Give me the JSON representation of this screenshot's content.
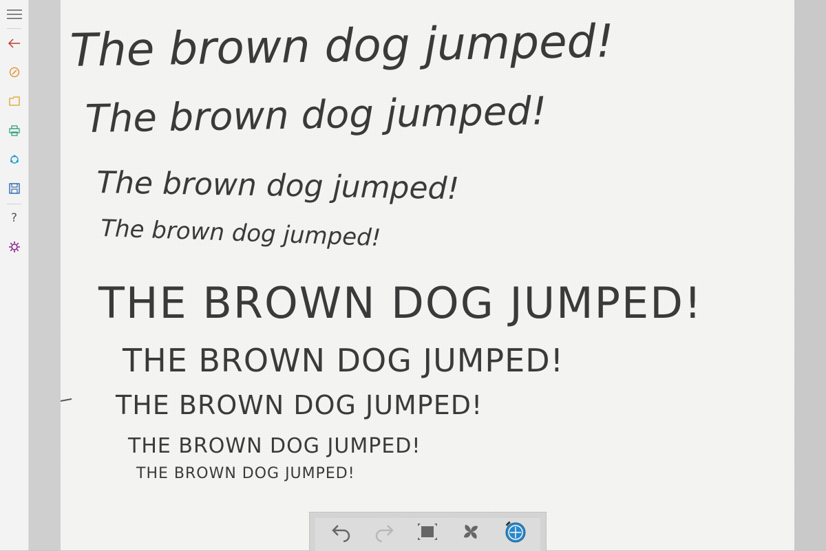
{
  "sidebar": {
    "icons": [
      "menu-icon",
      "back-arrow-icon",
      "pen-color-icon",
      "folder-icon",
      "print-icon",
      "share-icon",
      "save-icon",
      "help-icon",
      "settings-icon"
    ],
    "help_glyph": "?"
  },
  "colors": {
    "back": "#c0392b",
    "pen": "#e08a1e",
    "folder": "#e0a21e",
    "print": "#1e9e6e",
    "share": "#1a9bd0",
    "save": "#1f5fa8",
    "help": "#555555",
    "settings": "#8b1f8f",
    "ink": "#3a3a3a",
    "accent": "#2a88c8"
  },
  "document": {
    "lines": [
      "The brown dog jumped!",
      "The brown dog jumped!",
      "The brown dog jumped!",
      "The brown dog jumped!",
      "THE BROWN DOG JUMPED!",
      "THE BROWN DOG JUMPED!",
      "THE BROWN DOG JUMPED!",
      "THE BROWN DOG JUMPED!",
      "THE BROWN DOG JUMPED!"
    ]
  },
  "toolbar": {
    "icons": [
      "undo-icon",
      "redo-icon",
      "fit-to-screen-icon",
      "pinwheel-icon",
      "pen-tool-icon"
    ]
  }
}
